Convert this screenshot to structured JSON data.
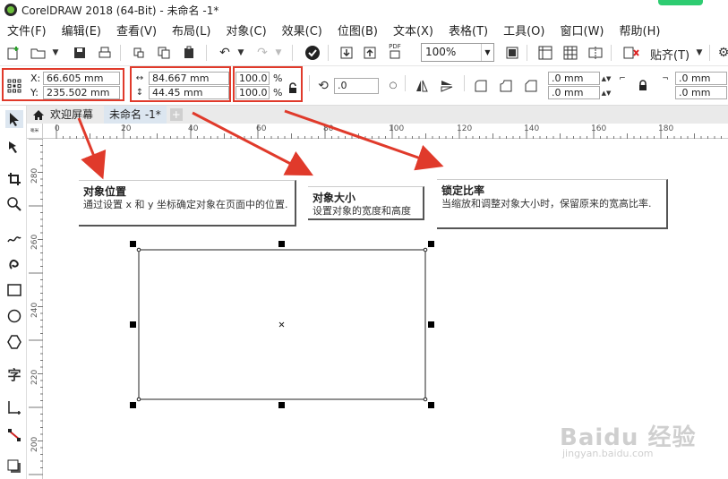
{
  "titlebar": {
    "title": "CorelDRAW 2018 (64-Bit) - 未命名 -1*"
  },
  "menubar": {
    "items": [
      "文件(F)",
      "编辑(E)",
      "查看(V)",
      "布局(L)",
      "对象(C)",
      "效果(C)",
      "位图(B)",
      "文本(X)",
      "表格(T)",
      "工具(O)",
      "窗口(W)",
      "帮助(H)"
    ]
  },
  "toolbar": {
    "zoom_value": "100%",
    "snap_label": "贴齐(T)",
    "pdf_label": "PDF"
  },
  "propbar": {
    "x_label": "X:",
    "x_value": "66.605 mm",
    "y_label": "Y:",
    "y_value": "235.502 mm",
    "width_value": "84.667 mm",
    "height_value": "44.45 mm",
    "scale_w": "100.0",
    "scale_h": "100.0",
    "percent": "%",
    "rotation_value": ".0",
    "corner1": ".0 mm",
    "corner2": ".0 mm",
    "corner3": ".0 mm",
    "corner4": ".0 mm"
  },
  "tabs": {
    "welcome": "欢迎屏幕",
    "document": "未命名 -1*",
    "add": "+"
  },
  "ruler": {
    "top_labels": [
      "0",
      "20",
      "40",
      "60",
      "80",
      "100",
      "120",
      "140",
      "160",
      "180"
    ],
    "left_labels": [
      "280",
      "260",
      "240",
      "220",
      "200"
    ],
    "corner_unit": "毫米"
  },
  "callouts": {
    "position": {
      "title": "对象位置",
      "desc": "通过设置 x 和 y 坐标确定对象在页面中的位置."
    },
    "size": {
      "title": "对象大小",
      "desc": "设置对象的宽度和高度"
    },
    "lock": {
      "title": "锁定比率",
      "desc": "当缩放和调整对象大小时，保留原来的宽高比率."
    }
  },
  "watermark": {
    "logo": "Baidu 经验",
    "url": "jingyan.baidu.com"
  },
  "colors": {
    "highlight": "#e03a2b",
    "arrow": "#e03a2b",
    "selection": "#000000"
  }
}
